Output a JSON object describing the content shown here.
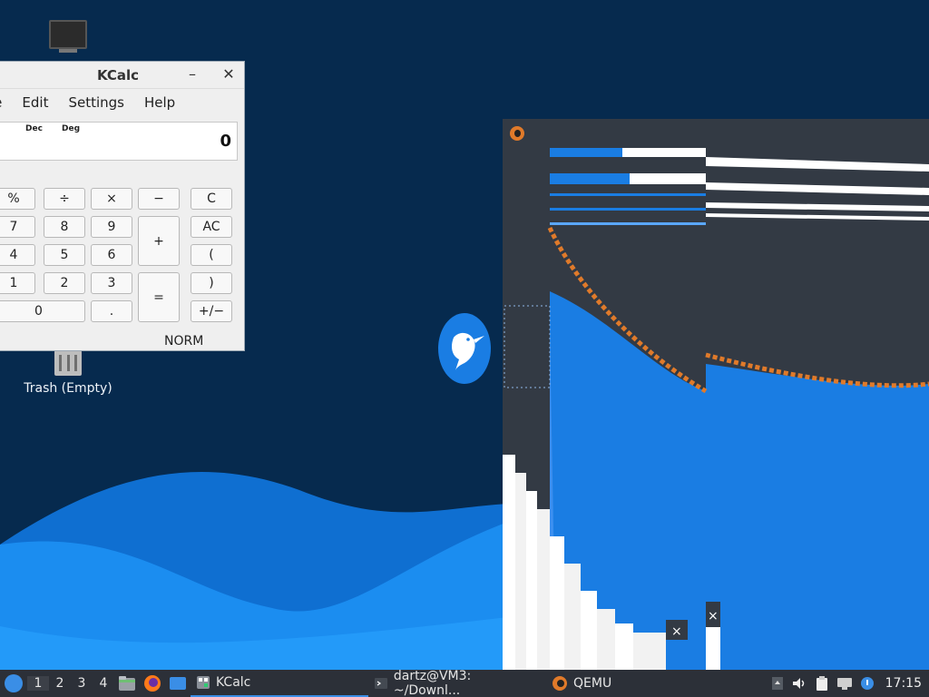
{
  "desktop": {
    "trash_label": "Trash (Empty)"
  },
  "kcalc": {
    "title": "KCalc",
    "menu": [
      "le",
      "Edit",
      "Settings",
      "Help"
    ],
    "display": {
      "base": "Dec",
      "angle": "Deg",
      "value": "0"
    },
    "mode_label": "NORM",
    "buttons": {
      "percent": "%",
      "divide": "÷",
      "multiply": "×",
      "minus": "−",
      "clear": "C",
      "seven": "7",
      "eight": "8",
      "nine": "9",
      "plus": "+",
      "all_clear": "AC",
      "four": "4",
      "five": "5",
      "six": "6",
      "open_paren": "(",
      "one": "1",
      "two": "2",
      "three": "3",
      "equals": "=",
      "close_paren": ")",
      "zero": "0",
      "dot": ".",
      "plus_minus": "+/−"
    }
  },
  "taskbar": {
    "workspaces": [
      "1",
      "2",
      "3",
      "4"
    ],
    "tasks": {
      "kcalc": "KCalc",
      "terminal": "dartz@VM3: ~/Downl...",
      "qemu": "QEMU"
    },
    "clock": "17:15"
  },
  "colors": {
    "desktop_bg": "#062a4e",
    "wave_light": "#1b8df0",
    "wave_mid": "#0f6fd1",
    "accent": "#3a8ee6",
    "qemu_orange": "#e07a2a"
  }
}
